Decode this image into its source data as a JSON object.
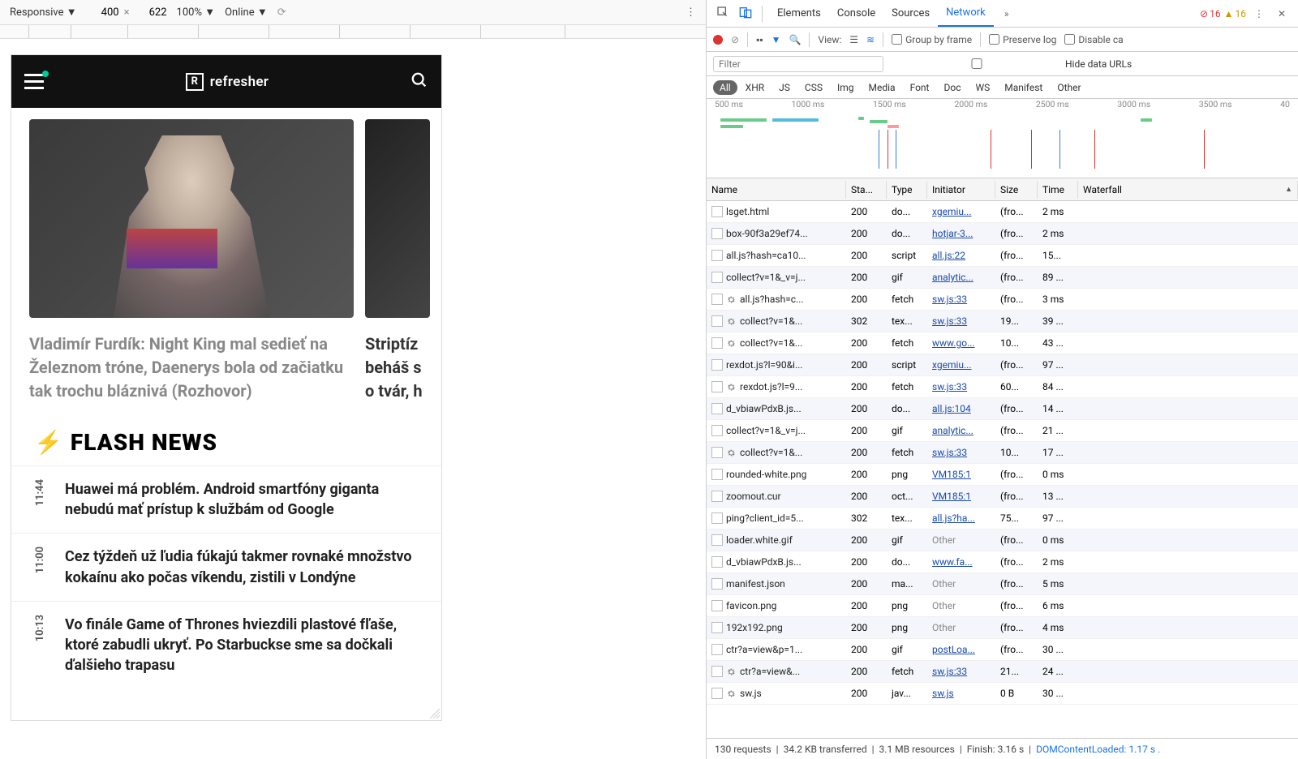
{
  "device_toolbar": {
    "device": "Responsive",
    "width": "400",
    "height": "622",
    "zoom": "100%",
    "throttle": "Online"
  },
  "phone": {
    "brand": "refresher",
    "card1_title": "Vladimír Furdík: Night King mal sedieť na Železnom tróne, Daenerys bola od začiatku tak trochu bláznivá (Rozhovor)",
    "card2_title": "Striptíz beháš s o tvár, h",
    "flash_title": "FLASH NEWS",
    "flash": [
      {
        "time": "11:44",
        "text": "Huawei má problém. Android smartfóny giganta nebudú mať prístup k službám od Google"
      },
      {
        "time": "11:00",
        "text": "Cez týždeň už ľudia fúkajú takmer rovnaké množstvo kokaínu ako počas víkendu, zistili v Londýne"
      },
      {
        "time": "10:13",
        "text": "Vo finále Game of Thrones hviezdili plastové fľaše, ktoré zabudli ukryť. Po Starbuckse sme sa dočkali ďalšieho trapasu"
      }
    ]
  },
  "devtools": {
    "tabs": [
      "Elements",
      "Console",
      "Sources",
      "Network"
    ],
    "active_tab": "Network",
    "errors": "16",
    "warnings": "16",
    "view_label": "View:",
    "group_by_frame": "Group by frame",
    "preserve_log": "Preserve log",
    "disable_cache": "Disable ca",
    "hide_data_urls": "Hide data URLs",
    "filter_placeholder": "Filter",
    "types": [
      "All",
      "XHR",
      "JS",
      "CSS",
      "Img",
      "Media",
      "Font",
      "Doc",
      "WS",
      "Manifest",
      "Other"
    ],
    "timeline_ticks": [
      "500 ms",
      "1000 ms",
      "1500 ms",
      "2000 ms",
      "2500 ms",
      "3000 ms",
      "3500 ms",
      "40"
    ],
    "columns": {
      "name": "Name",
      "status": "Sta...",
      "type": "Type",
      "initiator": "Initiator",
      "size": "Size",
      "time": "Time",
      "waterfall": "Waterfall"
    }
  },
  "requests": [
    {
      "name": "lsget.html",
      "gear": false,
      "status": "200",
      "type": "do...",
      "init": "xgemiu...",
      "link": true,
      "size": "(fro...",
      "time": "2 ms",
      "wf": {
        "l": 38,
        "w": 2,
        "c": "#7bc"
      }
    },
    {
      "name": "box-90f3a29ef74...",
      "gear": false,
      "status": "200",
      "type": "do...",
      "init": "hotjar-3...",
      "link": true,
      "size": "(fro...",
      "time": "2 ms",
      "wf": {
        "l": 40,
        "w": 3,
        "c": "#5bd"
      }
    },
    {
      "name": "all.js?hash=ca10...",
      "gear": false,
      "status": "200",
      "type": "script",
      "init": "all.js:22",
      "link": true,
      "size": "(fro...",
      "time": "15...",
      "wf": {
        "l": 40,
        "w": 6,
        "c": "#3a7bd5"
      }
    },
    {
      "name": "collect?v=1&_v=j...",
      "gear": false,
      "status": "200",
      "type": "gif",
      "init": "analytic...",
      "link": true,
      "size": "(fro...",
      "time": "89 ...",
      "wf": {
        "l": 41,
        "w": 3,
        "c": "#3c9"
      }
    },
    {
      "name": "all.js?hash=c...",
      "gear": true,
      "status": "200",
      "type": "fetch",
      "init": "sw.js:33",
      "link": true,
      "size": "(fro...",
      "time": "3 ms",
      "wf": {
        "l": 42,
        "w": 2,
        "c": "#6bd"
      }
    },
    {
      "name": "collect?v=1&...",
      "gear": true,
      "status": "302",
      "type": "tex...",
      "init": "sw.js:33",
      "link": true,
      "size": "19...",
      "time": "39 ...",
      "wf": {
        "l": 42,
        "w": 3,
        "c": "#3c9"
      }
    },
    {
      "name": "collect?v=1&...",
      "gear": true,
      "status": "200",
      "type": "fetch",
      "init": "www.go...",
      "link": true,
      "size": "10...",
      "time": "43 ...",
      "wf": {
        "l": 43,
        "w": 4,
        "c": "#3c9"
      }
    },
    {
      "name": "rexdot.js?l=90&i...",
      "gear": false,
      "status": "200",
      "type": "script",
      "init": "xgemiu...",
      "link": true,
      "size": "(fro...",
      "time": "97 ...",
      "wf": {
        "l": 45,
        "w": 4,
        "c": "#3c9"
      }
    },
    {
      "name": "rexdot.js?l=9...",
      "gear": true,
      "status": "200",
      "type": "fetch",
      "init": "sw.js:33",
      "link": true,
      "size": "60...",
      "time": "84 ...",
      "wf": {
        "l": 45,
        "w": 4,
        "c": "#3c9"
      }
    },
    {
      "name": "d_vbiawPdxB.js...",
      "gear": false,
      "status": "200",
      "type": "do...",
      "init": "all.js:104",
      "link": true,
      "size": "(fro...",
      "time": "14 ...",
      "wf": {
        "l": 46,
        "w": 2,
        "c": "#6bd"
      }
    },
    {
      "name": "collect?v=1&_v=j...",
      "gear": false,
      "status": "200",
      "type": "gif",
      "init": "analytic...",
      "link": true,
      "size": "(fro...",
      "time": "21 ...",
      "wf": {
        "l": 47,
        "w": 2,
        "c": "#3c9"
      }
    },
    {
      "name": "collect?v=1&...",
      "gear": true,
      "status": "200",
      "type": "fetch",
      "init": "sw.js:33",
      "link": true,
      "size": "10...",
      "time": "17 ...",
      "wf": {
        "l": 47,
        "w": 3,
        "c": "#5bd"
      }
    },
    {
      "name": "rounded-white.png",
      "gear": false,
      "status": "200",
      "type": "png",
      "init": "VM185:1",
      "link": true,
      "size": "(fro...",
      "time": "0 ms",
      "wf": {
        "l": 76,
        "w": 2,
        "c": "#6bd"
      }
    },
    {
      "name": "zoomout.cur",
      "gear": false,
      "status": "200",
      "type": "oct...",
      "init": "VM185:1",
      "link": true,
      "size": "(fro...",
      "time": "13 ...",
      "wf": {
        "l": 76,
        "w": 2,
        "c": "#6bd"
      }
    },
    {
      "name": "ping?client_id=5...",
      "gear": false,
      "status": "302",
      "type": "tex...",
      "init": "all.js?ha...",
      "link": true,
      "size": "75...",
      "time": "97 ...",
      "wf": {
        "l": 77,
        "w": 5,
        "c": "#3c9"
      }
    },
    {
      "name": "loader.white.gif",
      "gear": false,
      "status": "200",
      "type": "gif",
      "init": "Other",
      "link": false,
      "size": "(fro...",
      "time": "0 ms",
      "wf": {
        "l": 78,
        "w": 2,
        "c": "#6bd"
      }
    },
    {
      "name": "d_vbiawPdxB.js...",
      "gear": false,
      "status": "200",
      "type": "do...",
      "init": "www.fa...",
      "link": true,
      "size": "(fro...",
      "time": "2 ms",
      "wf": {
        "l": 78,
        "w": 2,
        "c": "#6bd"
      }
    },
    {
      "name": "manifest.json",
      "gear": false,
      "status": "200",
      "type": "ma...",
      "init": "Other",
      "link": false,
      "size": "(fro...",
      "time": "5 ms",
      "wf": {
        "l": 80,
        "w": 2,
        "c": "#6bd"
      }
    },
    {
      "name": "favicon.png",
      "gear": false,
      "status": "200",
      "type": "png",
      "init": "Other",
      "link": false,
      "size": "(fro...",
      "time": "6 ms",
      "wf": {
        "l": 80,
        "w": 2,
        "c": "#6bd"
      }
    },
    {
      "name": "192x192.png",
      "gear": false,
      "status": "200",
      "type": "png",
      "init": "Other",
      "link": false,
      "size": "(fro...",
      "time": "4 ms",
      "wf": {
        "l": 81,
        "w": 2,
        "c": "#6bd"
      }
    },
    {
      "name": "ctr?a=view&p=1...",
      "gear": false,
      "status": "200",
      "type": "gif",
      "init": "postLoa...",
      "link": true,
      "size": "(fro...",
      "time": "30 ...",
      "wf": {
        "l": 90,
        "w": 4,
        "c": "#3c9"
      }
    },
    {
      "name": "ctr?a=view&...",
      "gear": true,
      "status": "200",
      "type": "fetch",
      "init": "sw.js:33",
      "link": true,
      "size": "21...",
      "time": "24 ...",
      "wf": {
        "l": 90,
        "w": 3,
        "c": "#3c9"
      }
    },
    {
      "name": "sw.js",
      "gear": true,
      "status": "200",
      "type": "jav...",
      "init": "sw.js",
      "link": true,
      "size": "0 B",
      "time": "30 ...",
      "wf": {
        "l": 92,
        "w": 3,
        "c": "#3c9"
      }
    }
  ],
  "status": {
    "requests": "130 requests",
    "transferred": "34.2 KB transferred",
    "resources": "3.1 MB resources",
    "finish": "Finish: 3.16 s",
    "dcl": "DOMContentLoaded: 1.17 s ."
  }
}
